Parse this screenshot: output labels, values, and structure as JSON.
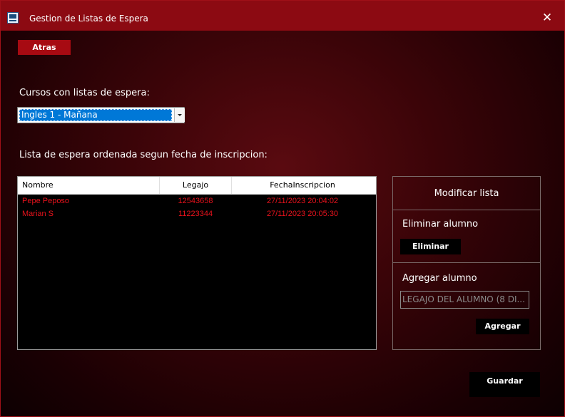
{
  "window": {
    "title": "Gestion de Listas de Espera",
    "close_glyph": "✕"
  },
  "back_button": "Atras",
  "courses_label": "Cursos con listas de espera:",
  "course_select": {
    "selected": "Ingles 1 - Mañana"
  },
  "waitlist_label": "Lista de espera ordenada segun fecha de inscripcion:",
  "grid": {
    "columns": [
      "Nombre",
      "Legajo",
      "FechaInscripcion"
    ],
    "rows": [
      {
        "nombre": "Pepe Peposo",
        "legajo": "12543658",
        "fecha": "27/11/2023 20:04:02"
      },
      {
        "nombre": "Marian S",
        "legajo": "11223344",
        "fecha": "27/11/2023 20:05:30"
      }
    ]
  },
  "side_panel": {
    "title": "Modificar lista",
    "remove_label": "Eliminar alumno",
    "remove_button": "Eliminar",
    "add_label": "Agregar alumno",
    "add_input_placeholder": "LEGAJO DEL ALUMNO (8 DI...",
    "add_button": "Agregar"
  },
  "save_button": "Guardar",
  "colors": {
    "titlebar": "#8c0a12",
    "accent_button": "#a70a12",
    "grid_text": "#e8121c"
  }
}
